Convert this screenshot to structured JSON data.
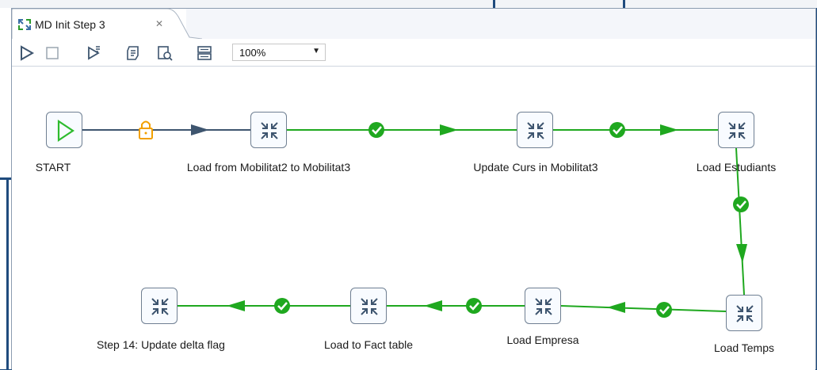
{
  "tab": {
    "title": "MD Init Step 3",
    "close_icon": "close-icon",
    "job_icon": "job-icon"
  },
  "toolbar": {
    "buttons": [
      "run-icon",
      "stop-icon",
      "preview-icon",
      "script-icon",
      "analyze-icon",
      "layout-icon"
    ],
    "zoom": "100%"
  },
  "nodes": {
    "start": "START",
    "load_mobilitat": "Load from Mobilitat2 to Mobilitat3",
    "update_curs": "Update Curs in Mobilitat3",
    "load_estudiants": "Load Estudiants",
    "load_temps": "Load Temps",
    "load_empresa": "Load Empresa",
    "load_fact": "Load to Fact table",
    "step14": "Step 14: Update delta flag"
  },
  "hops": [
    {
      "from": "START",
      "to": "Load from Mobilitat2 to Mobilitat3",
      "type": "unconditional",
      "icon": "lock-icon"
    },
    {
      "from": "Load from Mobilitat2 to Mobilitat3",
      "to": "Update Curs in Mobilitat3",
      "type": "success",
      "icon": "check-icon"
    },
    {
      "from": "Update Curs in Mobilitat3",
      "to": "Load Estudiants",
      "type": "success",
      "icon": "check-icon"
    },
    {
      "from": "Load Estudiants",
      "to": "Load Temps",
      "type": "success",
      "icon": "check-icon"
    },
    {
      "from": "Load Temps",
      "to": "Load Empresa",
      "type": "success",
      "icon": "check-icon"
    },
    {
      "from": "Load Empresa",
      "to": "Load to Fact table",
      "type": "success",
      "icon": "check-icon"
    },
    {
      "from": "Load to Fact table",
      "to": "Step 14: Update delta flag",
      "type": "success",
      "icon": "check-icon"
    }
  ],
  "colors": {
    "success_hop": "#1fa81f",
    "unconditional_hop": "#3e556f",
    "lock": "#f2a000",
    "start_icon": "#2dbb2d",
    "node_icon": "#3e556f",
    "frame": "#1f4b7d"
  }
}
